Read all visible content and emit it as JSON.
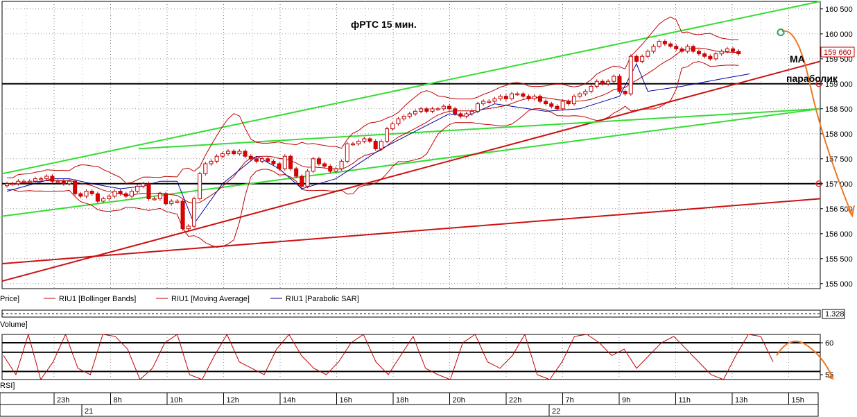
{
  "chart_data": {
    "type": "candlestick",
    "title": "фРТС   15 мин.",
    "annotations": {
      "ma": "МА",
      "parabolic": "параболик"
    },
    "price_axis": {
      "ticks": [
        "160 500",
        "160 000",
        "159 500",
        "159 000",
        "158 500",
        "158 000",
        "157 500",
        "157 000",
        "156 500",
        "156 000",
        "155 500",
        "155 000"
      ],
      "ylim": [
        154900,
        160650
      ],
      "last_price": "159 660",
      "levels": [
        159000,
        157000
      ]
    },
    "legend": [
      {
        "label": "Price]",
        "color": "#c00000"
      },
      {
        "label": "RIU1 [Bollinger Bands]",
        "color": "#c00000"
      },
      {
        "label": "RIU1 [Moving Average]",
        "color": "#c00000"
      },
      {
        "label": "RIU1 [Parabolic SAR]",
        "color": "#0000a0"
      }
    ],
    "volume_panel": {
      "label": "Volume]",
      "value": "1.328"
    },
    "rsi_panel": {
      "label": "RSI]",
      "ticks": [
        "60",
        "55"
      ],
      "levels": [
        60,
        58.5,
        55.5
      ]
    },
    "time_axis": {
      "hours": [
        "23h",
        "8h",
        "10h",
        "12h",
        "14h",
        "16h",
        "18h",
        "20h",
        "22h",
        "7h",
        "9h",
        "11h",
        "13h",
        "15h"
      ],
      "dates": [
        "21",
        "22"
      ]
    },
    "candles_close": [
      157000,
      157000,
      157050,
      157050,
      157050,
      157100,
      157100,
      157150,
      157050,
      157050,
      157000,
      157050,
      156800,
      156750,
      156850,
      156800,
      156650,
      156700,
      156750,
      156850,
      156800,
      156750,
      156850,
      156950,
      157000,
      156700,
      156700,
      156800,
      156600,
      156650,
      156650,
      156100,
      156150,
      156700,
      157200,
      157400,
      157450,
      157550,
      157600,
      157650,
      157600,
      157650,
      157550,
      157500,
      157450,
      157500,
      157450,
      157400,
      157300,
      157550,
      157300,
      157150,
      156950,
      157250,
      157500,
      157400,
      157350,
      157250,
      157300,
      157450,
      157800,
      157800,
      157850,
      157900,
      157850,
      157700,
      157850,
      158100,
      158200,
      158300,
      158350,
      158400,
      158450,
      158500,
      158450,
      158500,
      158500,
      158550,
      158500,
      158400,
      158350,
      158400,
      158450,
      158600,
      158650,
      158650,
      158700,
      158750,
      158700,
      158800,
      158800,
      158750,
      158700,
      158750,
      158650,
      158600,
      158550,
      158500,
      158650,
      158600,
      158750,
      158800,
      158850,
      158950,
      159050,
      159000,
      159050,
      159150,
      158850,
      158800,
      159550,
      159450,
      159550,
      159650,
      159750,
      159850,
      159800,
      159750,
      159700,
      159650,
      159750,
      159650,
      159600,
      159550,
      159500,
      159600,
      159650,
      159700,
      159650,
      159600
    ],
    "sar_points": [
      [
        0,
        156850
      ],
      [
        8,
        157100
      ],
      [
        11,
        157100
      ],
      [
        15,
        157000
      ],
      [
        20,
        156900
      ],
      [
        24,
        156950
      ],
      [
        27,
        157050
      ],
      [
        30,
        157050
      ],
      [
        33,
        156200
      ],
      [
        38,
        157000
      ],
      [
        44,
        157550
      ],
      [
        48,
        157300
      ],
      [
        52,
        156900
      ],
      [
        58,
        157100
      ],
      [
        66,
        157700
      ],
      [
        78,
        158400
      ],
      [
        81,
        158350
      ],
      [
        86,
        158600
      ],
      [
        95,
        158450
      ],
      [
        101,
        158500
      ],
      [
        108,
        158750
      ],
      [
        111,
        159400
      ],
      [
        113,
        158850
      ],
      [
        119,
        158950
      ],
      [
        126,
        159100
      ],
      [
        131,
        159200
      ]
    ],
    "rsi_values": [
      58,
      55,
      62,
      54,
      57,
      64,
      56,
      55,
      63,
      61,
      59,
      52,
      56,
      60,
      63,
      55,
      54,
      58,
      62,
      57,
      56,
      55,
      59,
      62,
      58,
      56,
      55,
      57,
      60,
      63,
      57,
      55,
      58,
      61,
      56,
      55,
      54,
      60,
      63,
      57,
      56,
      58,
      62,
      55,
      54,
      57,
      61,
      63,
      60,
      58,
      59,
      56,
      58,
      60,
      61,
      59,
      57,
      55,
      54,
      58,
      62,
      61,
      57
    ]
  }
}
